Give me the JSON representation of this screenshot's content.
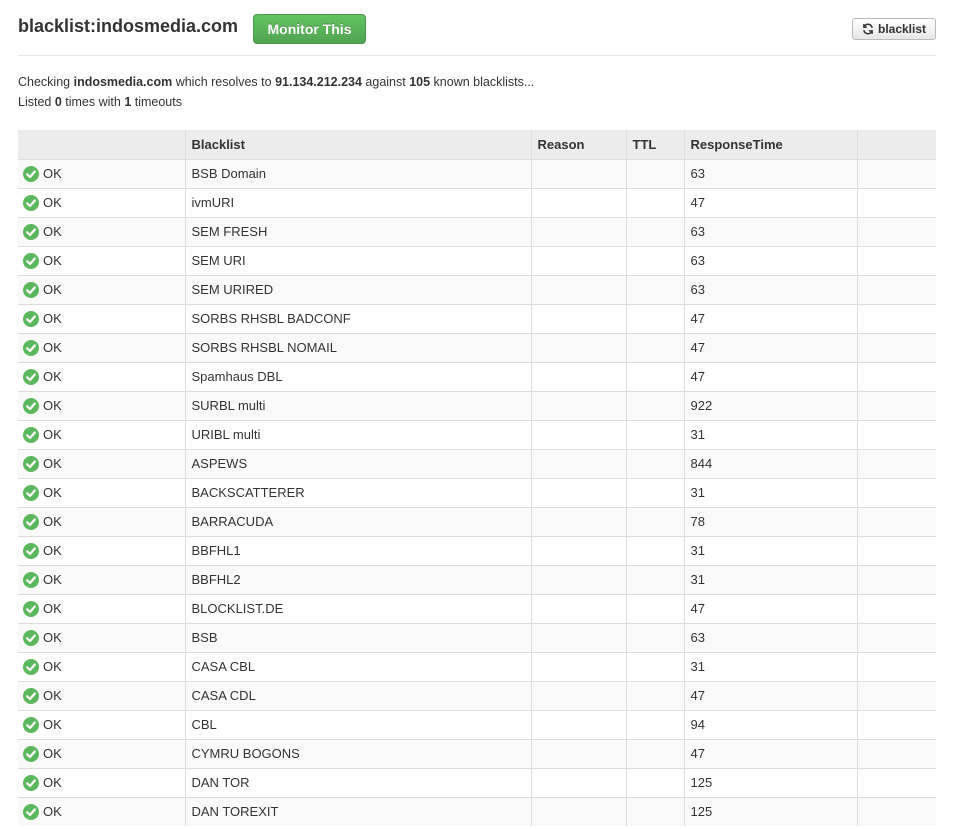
{
  "header": {
    "title": "blacklist:indosmedia.com",
    "monitor_label": "Monitor This",
    "refresh_label": "blacklist"
  },
  "summary": {
    "line1_prefix": "Checking ",
    "domain": "indosmedia.com",
    "line1_mid": " which resolves to ",
    "ip": "91.134.212.234",
    "line1_mid2": " against ",
    "count": "105",
    "line1_suffix": " known blacklists...",
    "line2_prefix": "Listed ",
    "listed": "0",
    "line2_mid": " times with ",
    "timeouts": "1",
    "line2_suffix": " timeouts"
  },
  "table": {
    "columns": [
      "",
      "Blacklist",
      "Reason",
      "TTL",
      "ResponseTime",
      ""
    ],
    "rows": [
      {
        "status": "OK",
        "blacklist": "BSB Domain",
        "reason": "",
        "ttl": "",
        "response": "63"
      },
      {
        "status": "OK",
        "blacklist": "ivmURI",
        "reason": "",
        "ttl": "",
        "response": "47"
      },
      {
        "status": "OK",
        "blacklist": "SEM FRESH",
        "reason": "",
        "ttl": "",
        "response": "63"
      },
      {
        "status": "OK",
        "blacklist": "SEM URI",
        "reason": "",
        "ttl": "",
        "response": "63"
      },
      {
        "status": "OK",
        "blacklist": "SEM URIRED",
        "reason": "",
        "ttl": "",
        "response": "63"
      },
      {
        "status": "OK",
        "blacklist": "SORBS RHSBL BADCONF",
        "reason": "",
        "ttl": "",
        "response": "47"
      },
      {
        "status": "OK",
        "blacklist": "SORBS RHSBL NOMAIL",
        "reason": "",
        "ttl": "",
        "response": "47"
      },
      {
        "status": "OK",
        "blacklist": "Spamhaus DBL",
        "reason": "",
        "ttl": "",
        "response": "47"
      },
      {
        "status": "OK",
        "blacklist": "SURBL multi",
        "reason": "",
        "ttl": "",
        "response": "922"
      },
      {
        "status": "OK",
        "blacklist": "URIBL multi",
        "reason": "",
        "ttl": "",
        "response": "31"
      },
      {
        "status": "OK",
        "blacklist": "ASPEWS",
        "reason": "",
        "ttl": "",
        "response": "844"
      },
      {
        "status": "OK",
        "blacklist": "BACKSCATTERER",
        "reason": "",
        "ttl": "",
        "response": "31"
      },
      {
        "status": "OK",
        "blacklist": "BARRACUDA",
        "reason": "",
        "ttl": "",
        "response": "78"
      },
      {
        "status": "OK",
        "blacklist": "BBFHL1",
        "reason": "",
        "ttl": "",
        "response": "31"
      },
      {
        "status": "OK",
        "blacklist": "BBFHL2",
        "reason": "",
        "ttl": "",
        "response": "31"
      },
      {
        "status": "OK",
        "blacklist": "BLOCKLIST.DE",
        "reason": "",
        "ttl": "",
        "response": "47"
      },
      {
        "status": "OK",
        "blacklist": "BSB",
        "reason": "",
        "ttl": "",
        "response": "63"
      },
      {
        "status": "OK",
        "blacklist": "CASA CBL",
        "reason": "",
        "ttl": "",
        "response": "31"
      },
      {
        "status": "OK",
        "blacklist": "CASA CDL",
        "reason": "",
        "ttl": "",
        "response": "47"
      },
      {
        "status": "OK",
        "blacklist": "CBL",
        "reason": "",
        "ttl": "",
        "response": "94"
      },
      {
        "status": "OK",
        "blacklist": "CYMRU BOGONS",
        "reason": "",
        "ttl": "",
        "response": "47"
      },
      {
        "status": "OK",
        "blacklist": "DAN TOR",
        "reason": "",
        "ttl": "",
        "response": "125"
      },
      {
        "status": "OK",
        "blacklist": "DAN TOREXIT",
        "reason": "",
        "ttl": "",
        "response": "125"
      }
    ]
  },
  "colors": {
    "ok_green": "#5cb85c",
    "monitor_green": "#5bb75b",
    "header_bg": "#ececec",
    "row_alt": "#f9f9f9",
    "border": "#dddddd"
  },
  "icons": {
    "status": "check-circle-icon",
    "refresh": "refresh-icon"
  }
}
